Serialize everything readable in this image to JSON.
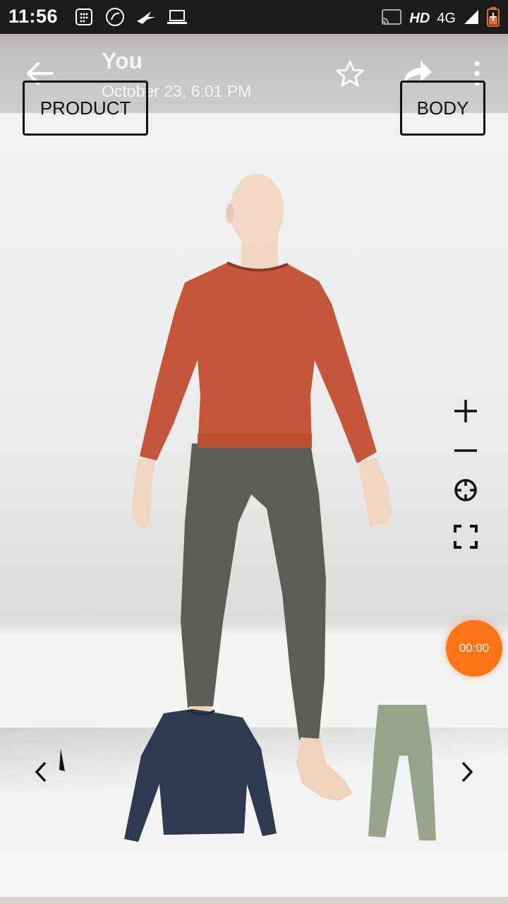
{
  "status_bar": {
    "time": "11:56",
    "network_label": "HD",
    "network_type": "4G",
    "icons": [
      "sim-icon",
      "calculator-icon",
      "phone-call-icon",
      "bird-icon",
      "laptop-icon",
      "cast-icon",
      "signal-icon",
      "battery-icon"
    ]
  },
  "header": {
    "title": "You",
    "subtitle": "October 23, 6:01 PM",
    "product_label": "PRODUCT",
    "body_label": "BODY"
  },
  "controls": [
    "zoom-in-icon",
    "zoom-out-icon",
    "recenter-icon",
    "fullscreen-icon"
  ],
  "timer": {
    "value": "00:00",
    "color": "#ff7417"
  },
  "garments": {
    "shirt_color": "#c4573a",
    "pants_color": "#5a5a56",
    "thumbnail_shirt_color": "#2e3a4f",
    "thumbnail_pants_color": "#9aa48a"
  }
}
